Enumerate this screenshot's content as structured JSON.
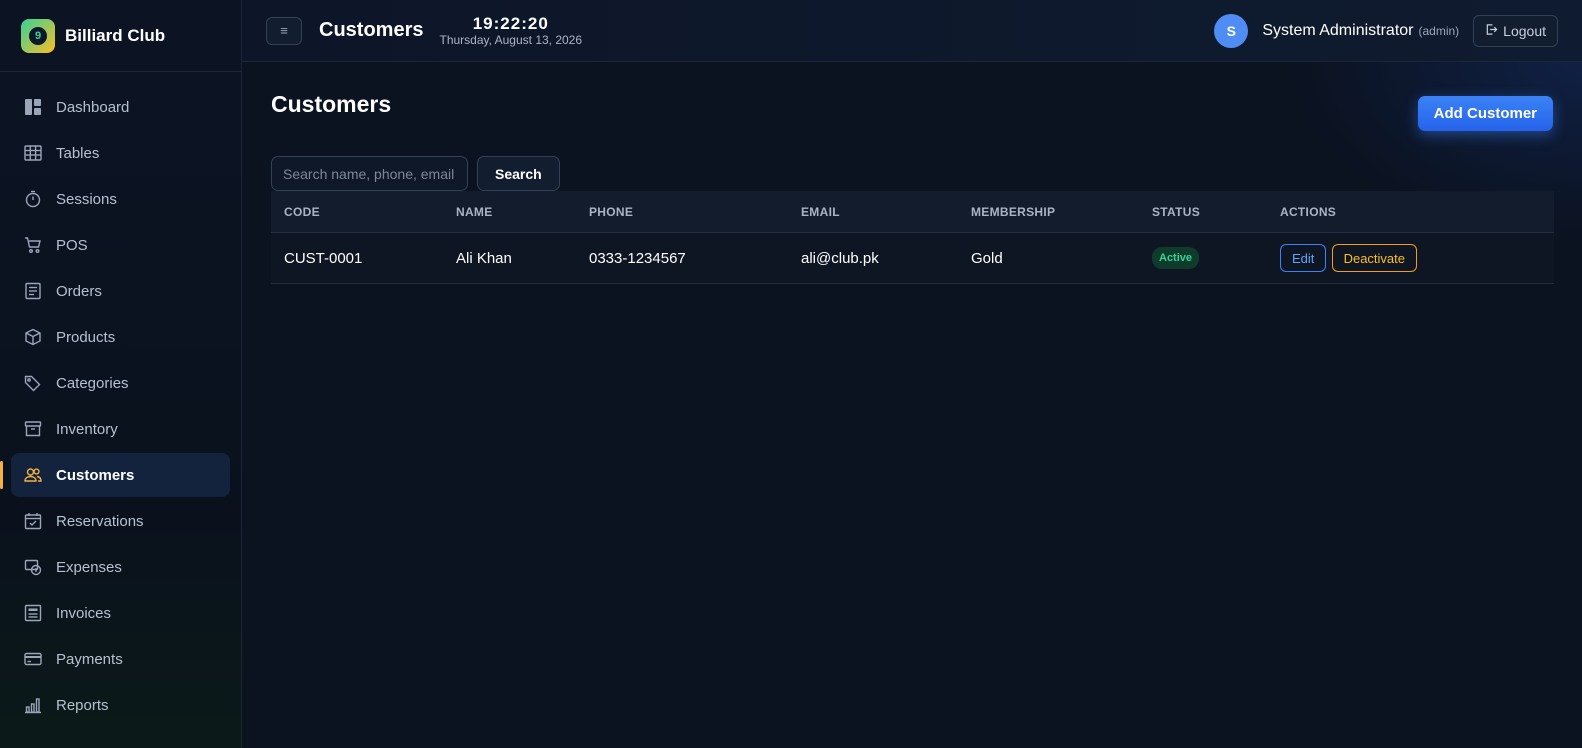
{
  "brand": {
    "name": "Billiard Club",
    "logo_glyph": "9"
  },
  "sidebar": {
    "items": [
      {
        "label": "Dashboard",
        "icon": "dashboard-icon"
      },
      {
        "label": "Tables",
        "icon": "table-grid-icon"
      },
      {
        "label": "Sessions",
        "icon": "timer-icon"
      },
      {
        "label": "POS",
        "icon": "cart-icon"
      },
      {
        "label": "Orders",
        "icon": "receipt-icon"
      },
      {
        "label": "Products",
        "icon": "box-icon"
      },
      {
        "label": "Categories",
        "icon": "tag-icon"
      },
      {
        "label": "Inventory",
        "icon": "archive-icon"
      },
      {
        "label": "Customers",
        "icon": "users-icon",
        "active": true
      },
      {
        "label": "Reservations",
        "icon": "calendar-check-icon"
      },
      {
        "label": "Expenses",
        "icon": "money-icon"
      },
      {
        "label": "Invoices",
        "icon": "invoice-icon"
      },
      {
        "label": "Payments",
        "icon": "card-icon"
      },
      {
        "label": "Reports",
        "icon": "bar-chart-icon"
      }
    ]
  },
  "topbar": {
    "menu_glyph": "≡",
    "title": "Customers",
    "time": "19:22:20",
    "date": "Thursday, August 13, 2026",
    "user_initial": "S",
    "user_name": "System Administrator",
    "user_role": "(admin)",
    "logout_label": "Logout"
  },
  "page": {
    "title": "Customers",
    "add_button": "Add Customer",
    "search_placeholder": "Search name, phone, email",
    "search_button": "Search"
  },
  "table": {
    "columns": [
      "Code",
      "Name",
      "Phone",
      "Email",
      "Membership",
      "Status",
      "Actions"
    ],
    "rows": [
      {
        "code": "CUST-0001",
        "name": "Ali Khan",
        "phone": "0333-1234567",
        "email": "ali@club.pk",
        "membership": "Gold",
        "status": "Active",
        "edit_label": "Edit",
        "deactivate_label": "Deactivate"
      }
    ]
  },
  "colors": {
    "accent": "#3b82f6",
    "active_nav_marker": "#f5b041",
    "status_active": "#34d399",
    "deactivate": "#f59e0b"
  }
}
